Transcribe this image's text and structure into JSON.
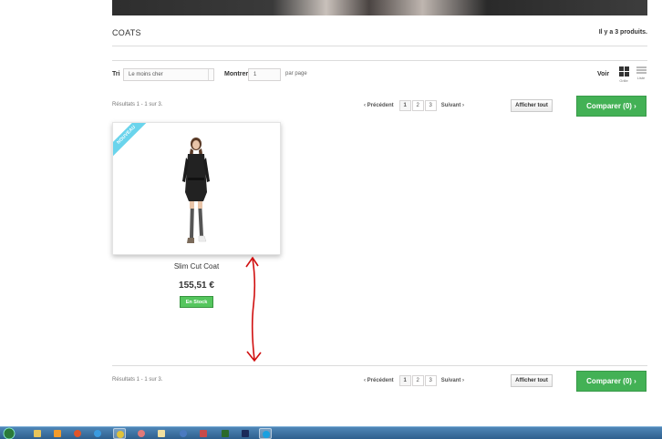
{
  "category": {
    "title": "COATS",
    "product_count": "Il y a 3 produits."
  },
  "toolbar": {
    "sort_label": "Tri",
    "sort_value": "Le moins cher",
    "show_label": "Montrer",
    "show_value": "1",
    "per_page": "par page",
    "view_label": "Voir",
    "grid_label": "Grille",
    "list_label": "Liste"
  },
  "pagination": {
    "results": "Résultats 1 - 1 sur 3.",
    "previous": "Précédent",
    "pages": [
      "1",
      "2",
      "3"
    ],
    "current_page": "1",
    "next": "Suivant",
    "show_all": "Afficher tout",
    "compare": "Comparer (0)"
  },
  "product": {
    "badge": "NOUVEAU",
    "name": "Slim Cut Coat",
    "price": "155,51 €",
    "availability": "En Stock"
  },
  "colors": {
    "compare_green": "#43b155",
    "stock_green": "#55c65e",
    "badge_blue": "#6ad4ec",
    "annotation_red": "#d01010"
  },
  "taskbar": {
    "icons": [
      "start-orb-icon",
      "explorer-icon",
      "media-player-icon",
      "firefox-icon",
      "internet-explorer-icon",
      "chrome-icon",
      "app-icon",
      "app-icon",
      "app-icon",
      "paint-icon",
      "dreamweaver-icon",
      "photoshop-icon",
      "skype-icon"
    ]
  }
}
